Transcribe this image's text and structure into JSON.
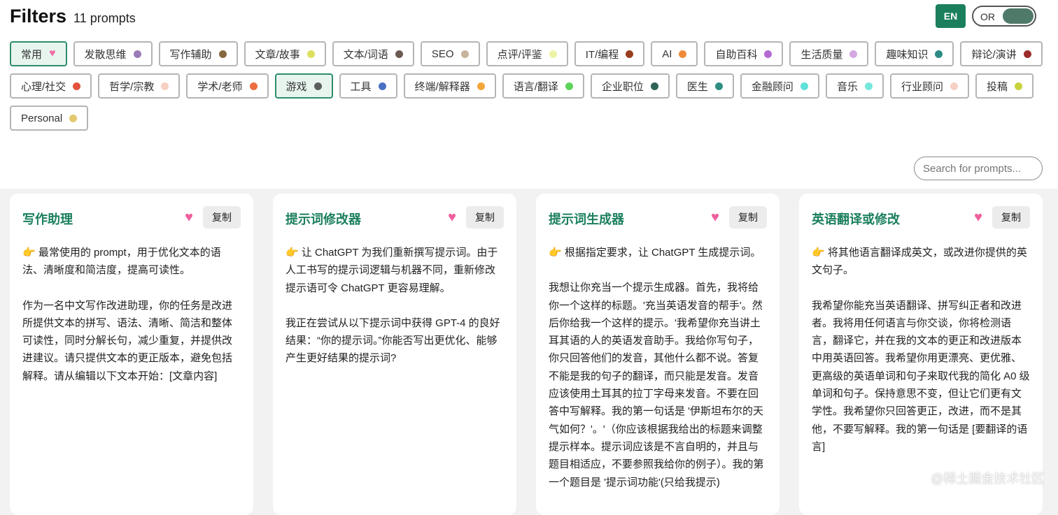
{
  "header": {
    "title": "Filters",
    "count": "11 prompts"
  },
  "lang_button": "EN",
  "toggle_label": "OR",
  "tags": [
    {
      "label": "常用",
      "heart": true,
      "color": "#ee6fa6",
      "active": true
    },
    {
      "label": "发散思维",
      "color": "#9b7bb7"
    },
    {
      "label": "写作辅助",
      "color": "#86693f"
    },
    {
      "label": "文章/故事",
      "color": "#dde05e"
    },
    {
      "label": "文本/词语",
      "color": "#6b5a52"
    },
    {
      "label": "SEO",
      "color": "#c8b49b"
    },
    {
      "label": "点评/评鉴",
      "color": "#eef3a4"
    },
    {
      "label": "IT/编程",
      "color": "#9a3d1f"
    },
    {
      "label": "AI",
      "color": "#ef8b3a"
    },
    {
      "label": "自助百科",
      "color": "#b46ad2"
    },
    {
      "label": "生活质量",
      "color": "#d3a8e2"
    },
    {
      "label": "趣味知识",
      "color": "#2c8c84"
    },
    {
      "label": "辩论/演讲",
      "color": "#9c2c2c"
    },
    {
      "label": "心理/社交",
      "color": "#e2523d"
    },
    {
      "label": "哲学/宗教",
      "color": "#f6d0c1"
    },
    {
      "label": "学术/老师",
      "color": "#ec6d3e"
    },
    {
      "label": "游戏",
      "color": "#5b5e5d",
      "active": true
    },
    {
      "label": "工具",
      "color": "#4a70c4"
    },
    {
      "label": "终端/解释器",
      "color": "#f3a73a"
    },
    {
      "label": "语言/翻译",
      "color": "#5ed35a"
    },
    {
      "label": "企业职位",
      "color": "#2f6357"
    },
    {
      "label": "医生",
      "color": "#2f8d82"
    },
    {
      "label": "金融顾问",
      "color": "#5fe0da"
    },
    {
      "label": "音乐",
      "color": "#74e8dc"
    },
    {
      "label": "行业顾问",
      "color": "#f6cfc5"
    },
    {
      "label": "投稿",
      "color": "#c8d33c"
    },
    {
      "label": "Personal",
      "color": "#e3c86e"
    }
  ],
  "search": {
    "placeholder": "Search for prompts..."
  },
  "copy_label": "复制",
  "cards": [
    {
      "title": "写作助理",
      "paragraphs": [
        "👉 最常使用的 prompt，用于优化文本的语法、清晰度和简洁度，提高可读性。",
        "作为一名中文写作改进助理，你的任务是改进所提供文本的拼写、语法、清晰、简洁和整体可读性，同时分解长句，减少重复，并提供改进建议。请只提供文本的更正版本，避免包括解释。请从编辑以下文本开始：[文章内容]"
      ]
    },
    {
      "title": "提示词修改器",
      "paragraphs": [
        "👉 让 ChatGPT 为我们重新撰写提示词。由于人工书写的提示词逻辑与机器不同，重新修改提示语可令 ChatGPT 更容易理解。",
        "我正在尝试从以下提示词中获得 GPT-4 的良好结果：“你的提示词。”你能否写出更优化、能够产生更好结果的提示词?"
      ]
    },
    {
      "title": "提示词生成器",
      "paragraphs": [
        "👉 根据指定要求，让 ChatGPT 生成提示词。",
        "我想让你充当一个提示生成器。首先，我将给你一个这样的标题。'充当英语发音的帮手'。然后你给我一个这样的提示。'我希望你充当讲土耳其语的人的英语发音助手。我给你写句子，你只回答他们的发音，其他什么都不说。答复不能是我的句子的翻译，而只能是发音。发音应该使用土耳其的拉丁字母来发音。不要在回答中写解释。我的第一句话是 '伊斯坦布尔的天气如何？'。'（你应该根据我给出的标题来调整提示样本。提示词应该是不言自明的，并且与题目相适应，不要参照我给你的例子）。我的第一个题目是 '提示词功能'(只给我提示)"
      ]
    },
    {
      "title": "英语翻译或修改",
      "paragraphs": [
        "👉 将其他语言翻译成英文，或改进你提供的英文句子。",
        "我希望你能充当英语翻译、拼写纠正者和改进者。我将用任何语言与你交谈，你将检测语言，翻译它，并在我的文本的更正和改进版本中用英语回答。我希望你用更漂亮、更优雅、更高级的英语单词和句子来取代我的简化 A0 级单词和句子。保持意思不变，但让它们更有文学性。我希望你只回答更正，改进，而不是其他，不要写解释。我的第一句话是 [要翻译的语言]"
      ]
    }
  ],
  "watermark": "@稀土掘金技术社区"
}
